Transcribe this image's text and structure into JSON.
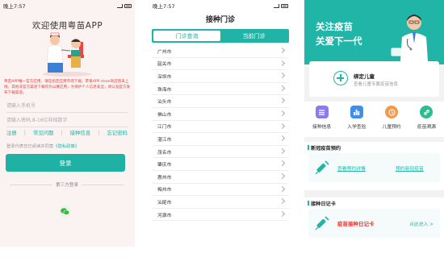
{
  "login": {
    "status_time": "晚上7:57",
    "title": "欢迎使用粤苗APP",
    "notice": "粤苗APP唯一官方应用，请在指定应用市场下载。苹果APP store商店暂未上线，其他非官方渠道下载均为山寨应用，为保护个人信息安全，请认准官方发布下载渠道。",
    "phone_placeholder": "请输入手机号",
    "password_placeholder": "请输入密码,8-16位非纯数字",
    "links": [
      "注册",
      "常见问题",
      "接种信息",
      "忘记密码"
    ],
    "agree_text": "登录代表您已阅读并同意",
    "agree_link": "《隐私政策》",
    "login_button": "登录",
    "third_party": "第三方登录",
    "wechat_icon": "wechat-icon"
  },
  "clinic": {
    "status_time": "晚上7:57",
    "title": "接种门诊",
    "tabs": [
      "门诊查询",
      "当前门诊"
    ],
    "cities": [
      "广州市",
      "韶关市",
      "深圳市",
      "珠海市",
      "汕头市",
      "佛山市",
      "江门市",
      "湛江市",
      "茂名市",
      "肇庆市",
      "惠州市",
      "梅州市",
      "汕尾市",
      "河源市"
    ]
  },
  "home": {
    "hero_line1": "关注疫苗",
    "hero_line2": "关爱下一代",
    "bind_title": "绑定儿童",
    "bind_sub": "查看儿童专属疫苗信息",
    "grid": [
      {
        "label": "接种信息",
        "icon": "list-icon",
        "color": "#8a7bf0"
      },
      {
        "label": "入学查验",
        "icon": "chart-icon",
        "color": "#3a8ff0"
      },
      {
        "label": "儿童预约",
        "icon": "clock-icon",
        "color": "#f39a4a"
      },
      {
        "label": "疫苗溯源",
        "icon": "link-icon",
        "color": "#2bbd8f"
      }
    ],
    "section1_title": "新冠疫苗预约",
    "section1_link1": "查看预约详情",
    "section1_link2": "预约新冠疫苗",
    "section2_title": "接种日记卡",
    "section2_card": "疫苗接种日记卡",
    "section2_enter": "点此进入 >",
    "accent": "#1fb1a3"
  }
}
